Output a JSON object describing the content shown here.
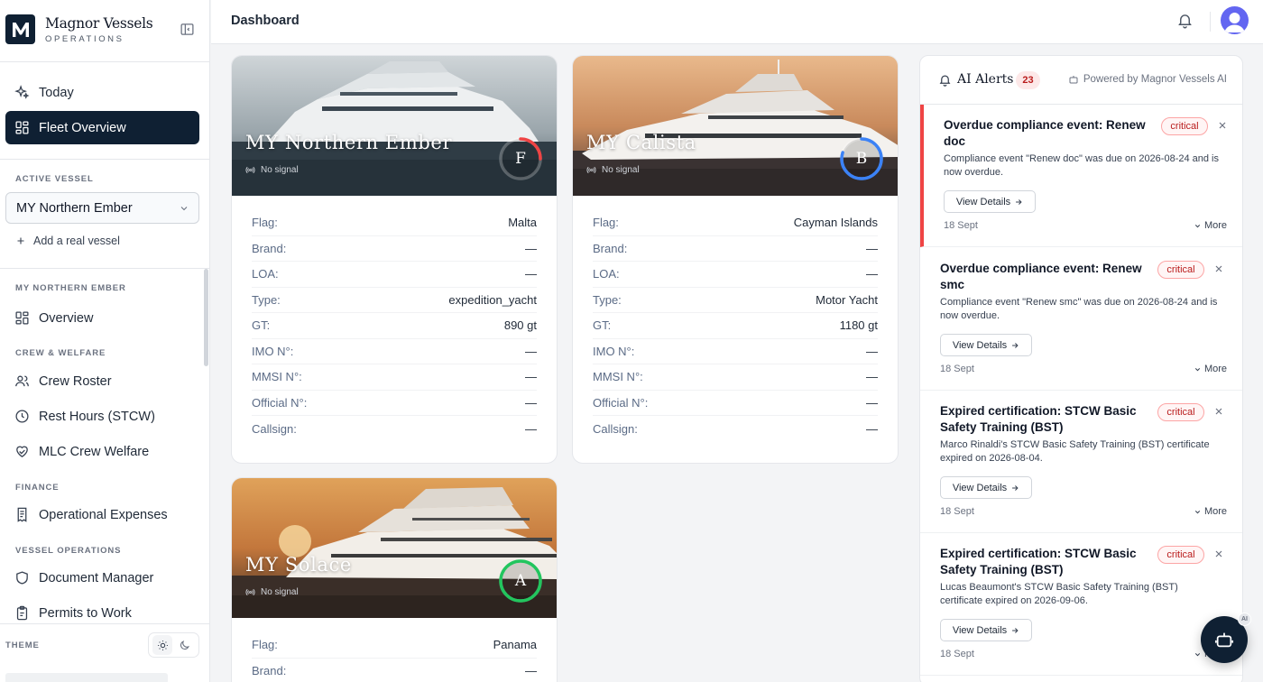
{
  "sidebar": {
    "brand_name": "Magnor Vessels",
    "brand_sub": "OPERATIONS",
    "today": "Today",
    "fleet_overview": "Fleet Overview",
    "active_vessel_label": "ACTIVE VESSEL",
    "active_vessel": "MY Northern Ember",
    "add_vessel": "Add a real vessel",
    "vessel_section": "MY NORTHERN EMBER",
    "overview": "Overview",
    "crew_section": "CREW & WELFARE",
    "crew_roster": "Crew Roster",
    "rest_hours": "Rest Hours (STCW)",
    "mlc_welfare": "MLC Crew Welfare",
    "finance_section": "FINANCE",
    "op_expenses": "Operational Expenses",
    "vessel_ops_section": "VESSEL OPERATIONS",
    "document_manager": "Document Manager",
    "permits": "Permits to Work",
    "theme_label": "THEME"
  },
  "header": {
    "title": "Dashboard"
  },
  "labels": {
    "flag": "Flag:",
    "brand": "Brand:",
    "loa": "LOA:",
    "type": "Type:",
    "gt": "GT:",
    "imo": "IMO N°:",
    "mmsi": "MMSI N°:",
    "official": "Official N°:",
    "callsign": "Callsign:"
  },
  "vessels": [
    {
      "name": "MY Northern Ember",
      "signal": "No signal",
      "grade": "F",
      "grade_color": "#ef4444",
      "grade_fraction": 0.25,
      "flag": "Malta",
      "brand": "—",
      "loa": "—",
      "type": "expedition_yacht",
      "gt": "890 gt",
      "imo": "—",
      "mmsi": "—",
      "official": "—",
      "callsign": "—"
    },
    {
      "name": "MY Calista",
      "signal": "No signal",
      "grade": "B",
      "grade_color": "#3b82f6",
      "grade_fraction": 0.8,
      "flag": "Cayman Islands",
      "brand": "—",
      "loa": "—",
      "type": "Motor Yacht",
      "gt": "1180 gt",
      "imo": "—",
      "mmsi": "—",
      "official": "—",
      "callsign": "—"
    },
    {
      "name": "MY Solace",
      "signal": "No signal",
      "grade": "A",
      "grade_color": "#22c55e",
      "grade_fraction": 1.0,
      "flag": "Panama",
      "brand": "—"
    }
  ],
  "alerts_panel": {
    "title": "AI Alerts",
    "count": "23",
    "powered_by": "Powered by Magnor Vessels AI",
    "view_details": "View Details",
    "more": "More",
    "items": [
      {
        "title": "Overdue compliance event: Renew doc",
        "desc": "Compliance event \"Renew doc\" was due on 2026-08-24 and is now overdue.",
        "severity": "critical",
        "date": "18 Sept"
      },
      {
        "title": "Overdue compliance event: Renew smc",
        "desc": "Compliance event \"Renew smc\" was due on 2026-08-24 and is now overdue.",
        "severity": "critical",
        "date": "18 Sept"
      },
      {
        "title": "Expired certification: STCW Basic Safety Training (BST)",
        "desc": "Marco Rinaldi's STCW Basic Safety Training (BST) certificate expired on 2026-08-04.",
        "severity": "critical",
        "date": "18 Sept"
      },
      {
        "title": "Expired certification: STCW Basic Safety Training (BST)",
        "desc": "Lucas Beaumont's STCW Basic Safety Training (BST) certificate expired on 2026-09-06.",
        "severity": "critical",
        "date": "18 Sept"
      }
    ]
  },
  "fab_tag": "AI",
  "colors": {
    "navy": "#0f2033",
    "critical": "#ef4444",
    "accent": "#6366f1"
  },
  "icons": [
    "layout-sidebar-icon",
    "bell-icon",
    "user-avatar-icon",
    "bot-icon",
    "signal-icon",
    "sun-icon",
    "moon-icon",
    "close-icon",
    "arrow-right-icon",
    "chevron-down-icon"
  ]
}
